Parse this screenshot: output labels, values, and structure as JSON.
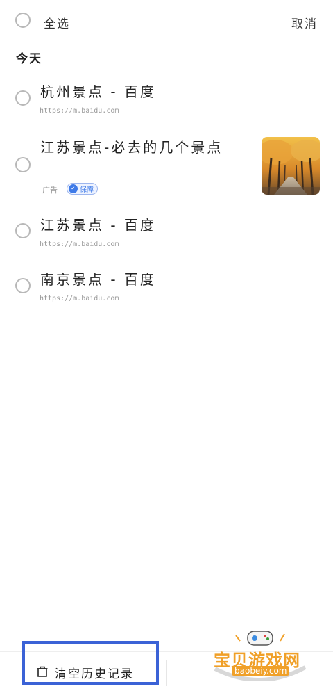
{
  "header": {
    "select_all_label": "全选",
    "cancel_label": "取消"
  },
  "section": {
    "title": "今天"
  },
  "items": [
    {
      "title": "杭州景点 - 百度",
      "url": "https://m.baidu.com"
    },
    {
      "title": "江苏景点-必去的几个景点",
      "ad_label": "广告",
      "badge_label": "保障"
    },
    {
      "title": "江苏景点 - 百度",
      "url": "https://m.baidu.com"
    },
    {
      "title": "南京景点 - 百度",
      "url": "https://m.baidu.com"
    }
  ],
  "bottom": {
    "clear_label": "清空历史记录"
  },
  "watermark": {
    "brand": "宝贝游戏网",
    "site": "baobeiy.com"
  },
  "colors": {
    "accent_blue": "#3f7be8",
    "highlight_box": "#3b62d6",
    "watermark": "#f0a028"
  },
  "icons": {
    "trash": "trash-icon",
    "shield": "shield-check-icon"
  }
}
